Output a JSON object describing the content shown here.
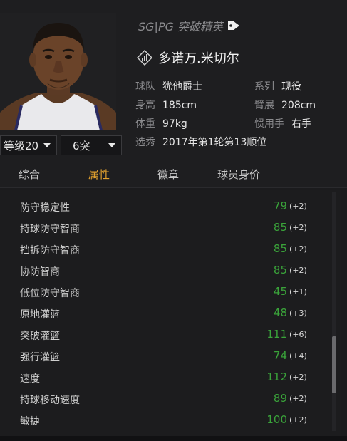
{
  "header": {
    "position_line": "SG|PG 突破精英",
    "player_name": "多诺万.米切尔",
    "level_dropdown": "等级20",
    "break_dropdown": "6突",
    "info": {
      "team_label": "球队",
      "team_value": "犹他爵士",
      "series_label": "系列",
      "series_value": "现役",
      "height_label": "身高",
      "height_value": "185cm",
      "wingspan_label": "臂展",
      "wingspan_value": "208cm",
      "weight_label": "体重",
      "weight_value": "97kg",
      "hand_label": "惯用手",
      "hand_value": "右手",
      "draft_label": "选秀",
      "draft_value": "2017年第1轮第13顺位"
    }
  },
  "tabs": [
    {
      "label": "综合",
      "active": false
    },
    {
      "label": "属性",
      "active": true
    },
    {
      "label": "徽章",
      "active": false
    },
    {
      "label": "球员身价",
      "active": false
    }
  ],
  "attributes": [
    {
      "name": "防守稳定性",
      "value": "79",
      "delta": "(+2)"
    },
    {
      "name": "持球防守智商",
      "value": "85",
      "delta": "(+2)"
    },
    {
      "name": "挡拆防守智商",
      "value": "85",
      "delta": "(+2)"
    },
    {
      "name": "协防智商",
      "value": "85",
      "delta": "(+2)"
    },
    {
      "name": "低位防守智商",
      "value": "45",
      "delta": "(+1)"
    },
    {
      "name": "原地灌篮",
      "value": "48",
      "delta": "(+3)"
    },
    {
      "name": "突破灌篮",
      "value": "111",
      "delta": "(+6)"
    },
    {
      "name": "强行灌篮",
      "value": "74",
      "delta": "(+4)"
    },
    {
      "name": "速度",
      "value": "112",
      "delta": "(+2)"
    },
    {
      "name": "持球移动速度",
      "value": "89",
      "delta": "(+2)"
    },
    {
      "name": "敏捷",
      "value": "100",
      "delta": "(+2)"
    }
  ],
  "colors": {
    "accent": "#e5a32e",
    "value_green": "#3aa33a",
    "background": "#1b1b1d"
  },
  "icons": {
    "tag": "tag-icon",
    "signal": "signal-badge-icon",
    "caret": "caret-down-icon"
  }
}
